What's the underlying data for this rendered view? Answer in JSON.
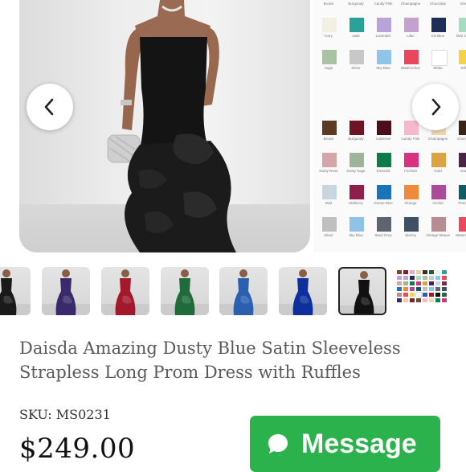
{
  "gallery": {
    "main_photo": "model-in-black-strapless-ruffle-gown",
    "prev_icon": "chevron-left-icon",
    "next_icon": "chevron-right-icon",
    "swatch_top_rows": [
      [
        [
          "Brown",
          "#6b4a33"
        ],
        [
          "Burgundy",
          "#7a1f2e"
        ],
        [
          "Candy Pink",
          "#f2a7c0"
        ],
        [
          "Champagne",
          "#e8cfa5"
        ],
        [
          "Chocolate",
          "#3f2a1d"
        ],
        [
          "Green",
          "#1f5a3b"
        ]
      ],
      [
        [
          "Ivory",
          "#f3efe2"
        ],
        [
          "Jade",
          "#2aa198"
        ],
        [
          "Lavender",
          "#b8a4d8"
        ],
        [
          "Lilac",
          "#c3a2cf"
        ],
        [
          "Ink Blue",
          "#1d2f57"
        ],
        [
          "Mint Green",
          "#a7dcc4"
        ]
      ],
      [
        [
          "Sage",
          "#a9c3a2"
        ],
        [
          "Silver",
          "#c8c8c8"
        ],
        [
          "Sky Blue",
          "#8ec5e8"
        ],
        [
          "Watermelon",
          "#e8475e"
        ],
        [
          "White",
          "#ffffff"
        ],
        [
          "Yellow",
          "#f3d34a"
        ]
      ]
    ],
    "swatch_bottom_rows": [
      [
        [
          "Brown",
          "#5a3a22"
        ],
        [
          "Burgundy",
          "#6e1424"
        ],
        [
          "Cabernet",
          "#4b0f1c"
        ],
        [
          "Candy Pink",
          "#f6b9cc"
        ],
        [
          "Champagne",
          "#efd7b1"
        ],
        [
          "Chocolate",
          "#3a2417"
        ]
      ],
      [
        [
          "Dusty Rose",
          "#d6a5a8"
        ],
        [
          "Dusty Sage",
          "#9fb39a"
        ],
        [
          "Emerald",
          "#0f7a4a"
        ],
        [
          "Fuchsia",
          "#d9307f"
        ],
        [
          "Gold",
          "#d9a441"
        ],
        [
          "Grape",
          "#4b2346"
        ]
      ],
      [
        [
          "Mist",
          "#c7d6df"
        ],
        [
          "Mulberry",
          "#8e1f4a"
        ],
        [
          "Ocean Blue",
          "#1c73b8"
        ],
        [
          "Orange",
          "#f08a3a"
        ],
        [
          "Orchid",
          "#a94b9a"
        ],
        [
          "Peacock",
          "#0f5c66"
        ]
      ],
      [
        [
          "Silver",
          "#bfbfbf"
        ],
        [
          "Sky Blue",
          "#8ec3e6"
        ],
        [
          "Steel Grey",
          "#5f6570"
        ],
        [
          "Stormy",
          "#3f4f66"
        ],
        [
          "Vintage Mauve",
          "#b78d93"
        ],
        [
          "Watermelon",
          "#e84a5f"
        ]
      ]
    ]
  },
  "thumbnails": [
    {
      "color": "#1a1a1a",
      "name": "thumb-partial"
    },
    {
      "color": "#3a2a6b",
      "name": "thumb-purple"
    },
    {
      "color": "#a3192b",
      "name": "thumb-red"
    },
    {
      "color": "#1f6b3a",
      "name": "thumb-green"
    },
    {
      "color": "#2b5fb0",
      "name": "thumb-blue"
    },
    {
      "color": "#0f2f9e",
      "name": "thumb-royal-blue"
    },
    {
      "color": "#111111",
      "name": "thumb-black",
      "selected": true
    }
  ],
  "mini_swatch_colors": [
    "#6b4a33",
    "#7a1f2e",
    "#f2a7c0",
    "#e8cfa5",
    "#3f2a1d",
    "#1f5a3b",
    "#f3efe2",
    "#2aa198",
    "#b8a4d8",
    "#c3a2cf",
    "#1d2f57",
    "#a7dcc4",
    "#a9c3a2",
    "#c8c8c8",
    "#8ec5e8",
    "#e8475e",
    "#d6a5a8",
    "#9fb39a",
    "#0f7a4a",
    "#d9307f",
    "#d9a441",
    "#4b2346",
    "#c7d6df",
    "#8e1f4a",
    "#1c73b8",
    "#f08a3a",
    "#a94b9a",
    "#0f5c66",
    "#bfbfbf",
    "#8ec3e6",
    "#5f6570",
    "#3f4f66",
    "#b78d93",
    "#e84a5f",
    "#f3d34a",
    "#ffffff",
    "#2b5fb0",
    "#a3192b",
    "#111111",
    "#1f6b3a",
    "#3a2a6b",
    "#e8cfa5",
    "#7a1f2e",
    "#6b4a33",
    "#f6b9cc",
    "#efd7b1",
    "#0f7a4a",
    "#d9307f"
  ],
  "product": {
    "title": "Daisda Amazing Dusty Blue Satin Sleeveless Strapless Long Prom Dress with Ruffles",
    "sku": "SKU: MS0231",
    "price": "$249.00"
  },
  "message_button": {
    "label": "Message",
    "color": "#2bb24c",
    "icon": "chat-bubble-icon"
  }
}
